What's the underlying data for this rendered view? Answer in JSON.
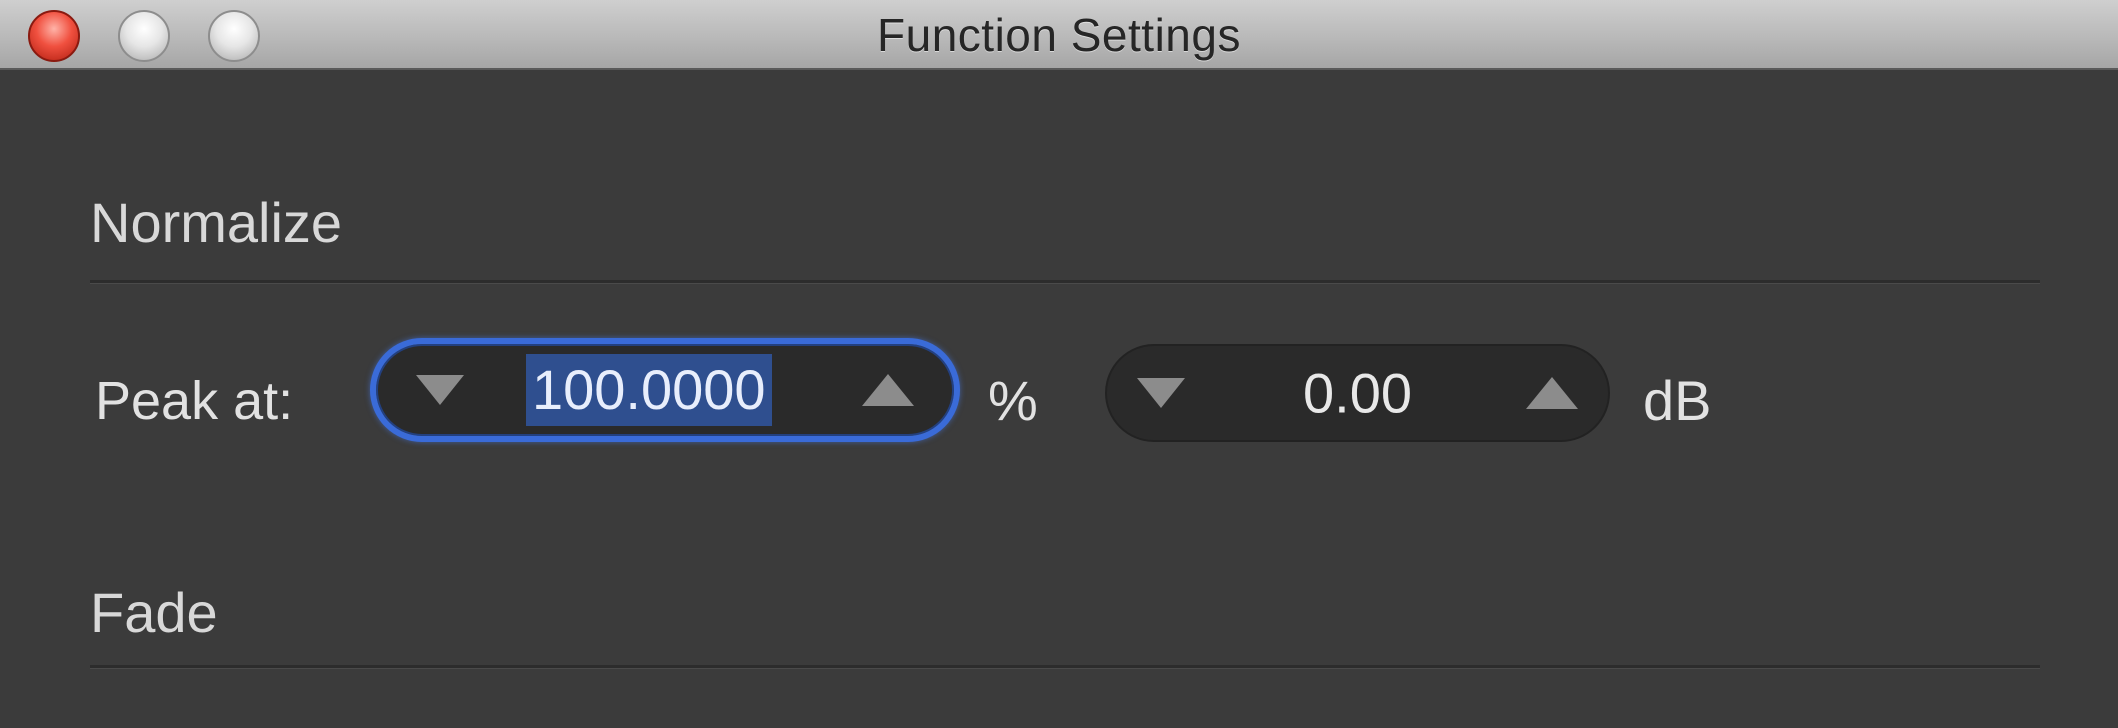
{
  "window": {
    "title": "Function Settings"
  },
  "sections": {
    "normalize": {
      "title": "Normalize",
      "peak_label": "Peak at:",
      "percent_value": "100.0000",
      "percent_unit": "%",
      "db_value": "0.00",
      "db_unit": "dB"
    },
    "fade": {
      "title": "Fade"
    }
  },
  "colors": {
    "background": "#3b3b3b",
    "focus_ring": "#3a6bd8",
    "selection": "#2f4f8f",
    "close_button": "#f0503f"
  },
  "icons": {
    "close": "close-button-icon",
    "minimize": "minimize-button-icon",
    "zoom": "zoom-button-icon",
    "decrement": "triangle-down-icon",
    "increment": "triangle-up-icon"
  }
}
